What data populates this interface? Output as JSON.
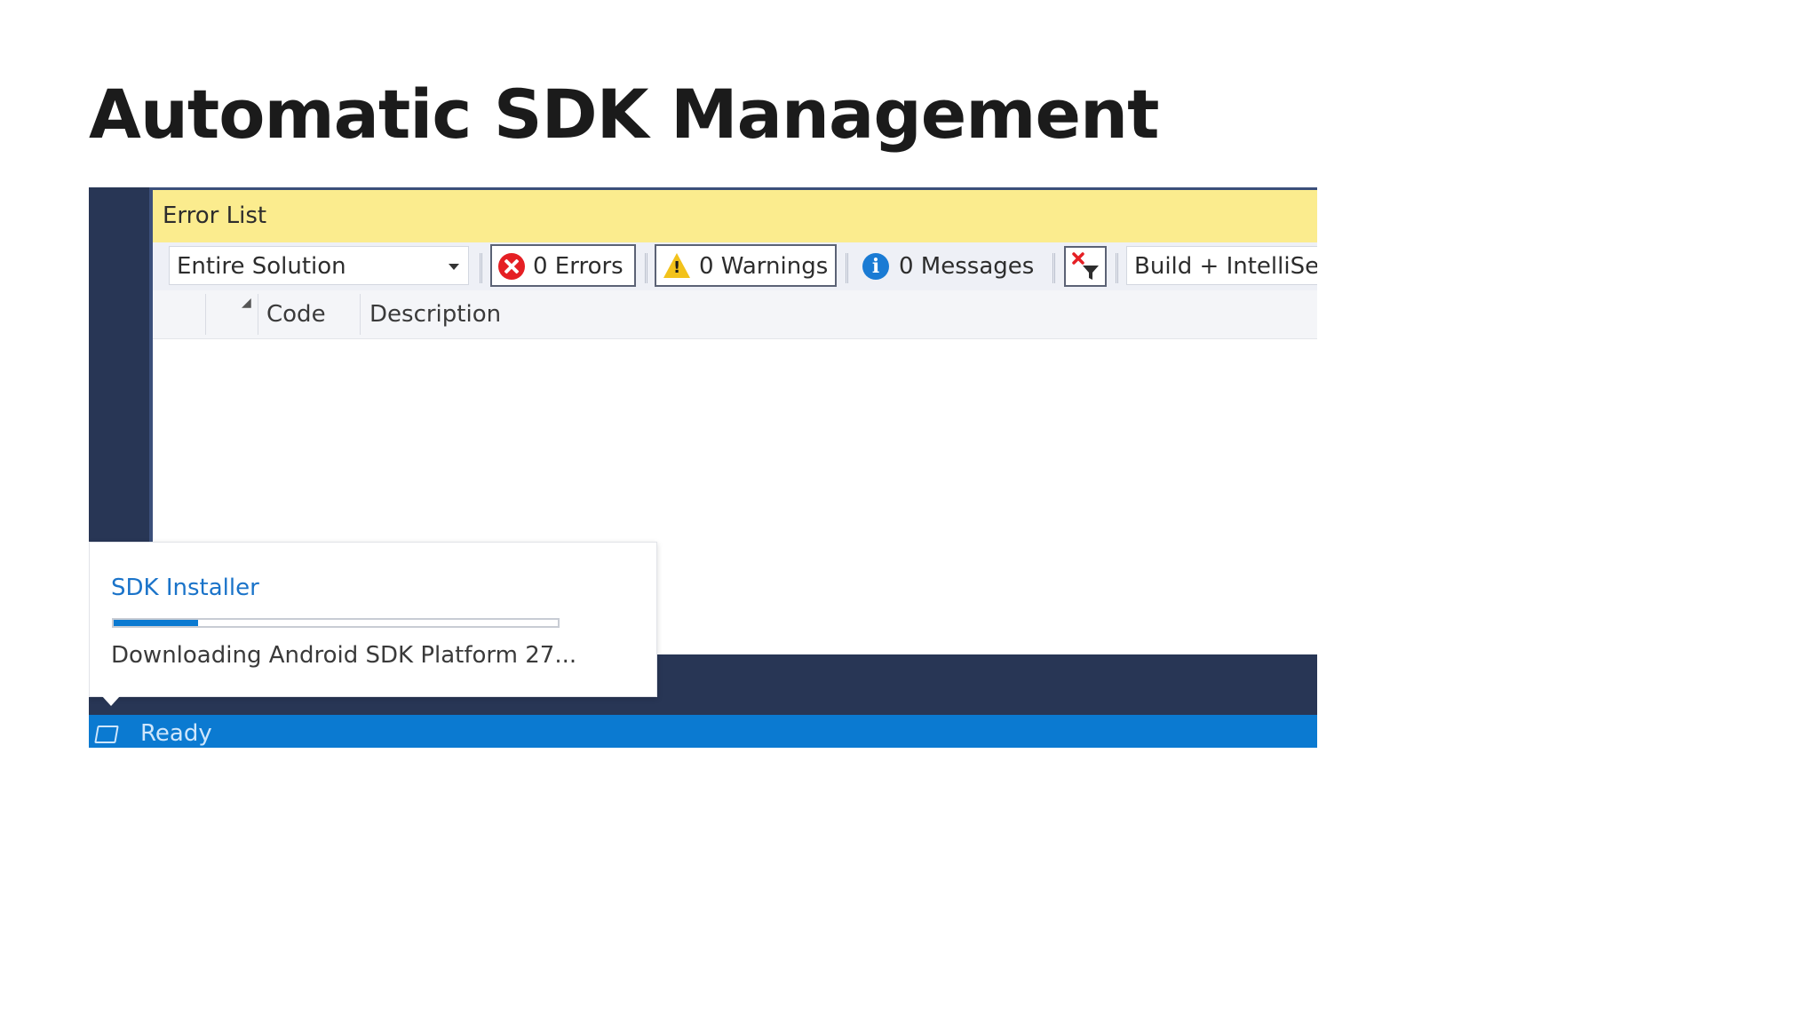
{
  "slide": {
    "title": "Automatic SDK Management"
  },
  "error_list": {
    "title": "Error List",
    "scope_select": {
      "selected": "Entire Solution"
    },
    "filters": {
      "errors_label": "0 Errors",
      "warnings_label": "0 Warnings",
      "messages_label": "0 Messages"
    },
    "build_select": {
      "selected": "Build + IntelliSen"
    },
    "columns": [
      "Code",
      "Description"
    ]
  },
  "toast": {
    "title": "SDK Installer",
    "progress": 0.19,
    "message": "Downloading Android SDK Platform 27..."
  },
  "status_bar": {
    "text": "Ready"
  },
  "icons": {
    "error": "error-circle-icon",
    "warning": "warning-triangle-icon",
    "info": "info-circle-icon",
    "clear_filter": "clear-filter-icon",
    "sort": "sort-icon",
    "status": "status-panel-icon"
  },
  "colors": {
    "titlebar_yellow": "#fbec8e",
    "ide_navy": "#283655",
    "status_blue": "#0b7ad1",
    "error_red": "#e51f24",
    "warning_yellow": "#f2c21b",
    "info_blue": "#1a7bd4",
    "toast_title_blue": "#1a73c9"
  }
}
